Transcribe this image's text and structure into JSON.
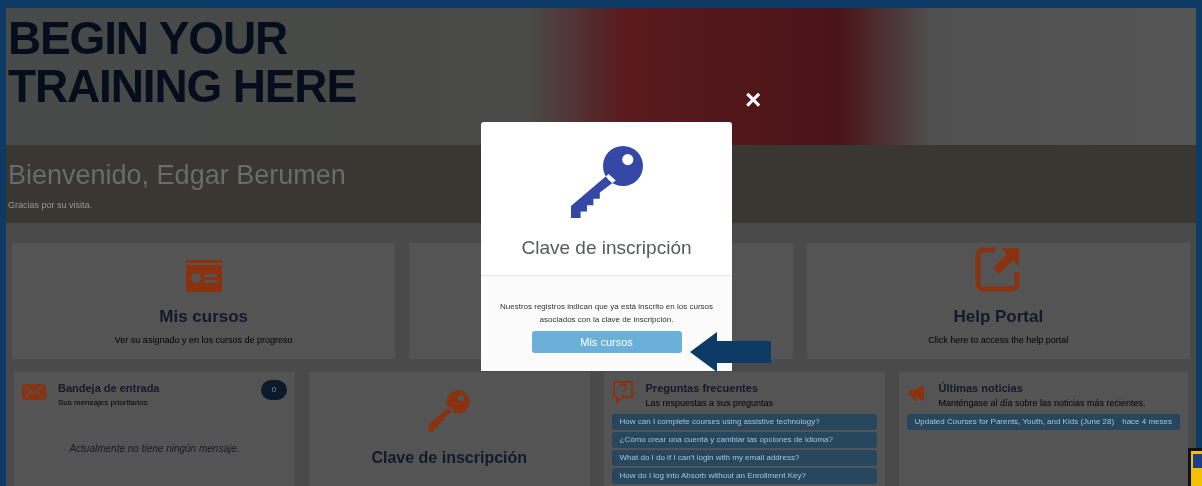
{
  "hero": {
    "title_lines": [
      "BEGIN YOUR",
      "TRAINING HERE"
    ],
    "welcome": "Bienvenido, Edgar Berumen",
    "subtitle": "Gracias por su visita."
  },
  "tiles": [
    {
      "kind": "courses",
      "title": "Mis cursos",
      "description": "Ver su asignado y en los cursos de progreso"
    },
    {
      "kind": "hidden"
    },
    {
      "kind": "help",
      "title": "Help Portal",
      "description": "Click here to access the help portal"
    }
  ],
  "inbox": {
    "title": "Bandeja de entrada",
    "subtitle": "Sus mensajes prioritarios",
    "count": "0",
    "empty_message": "Actualmente no tiene ningún mensaje."
  },
  "enrollment_tile": {
    "title": "Clave de inscripción"
  },
  "faq": {
    "title": "Preguntas frecuentes",
    "subtitle": "Las respuestas a sus preguntas",
    "items": [
      "How can I complete courses using assistive technology?",
      "¿Cómo crear una cuenta y cambiar las opciones de idioma?",
      "What do I do if I can't login with my email address?",
      "How do I log into Absorb without an Enrollment Key?"
    ]
  },
  "news": {
    "title": "Últimas noticias",
    "subtitle": "Manténgase al día sobre las noticias más recientes.",
    "items": [
      {
        "headline": "Updated Courses for Parents, Youth, and Kids (June 28)",
        "age": "hace 4 meses"
      }
    ]
  },
  "modal": {
    "title": "Clave de inscripción",
    "message": "Nuestros registros indican que ya está inscrito en los cursos asociados con la clave de inscripción.",
    "button": "Mis cursos",
    "close": "×"
  }
}
